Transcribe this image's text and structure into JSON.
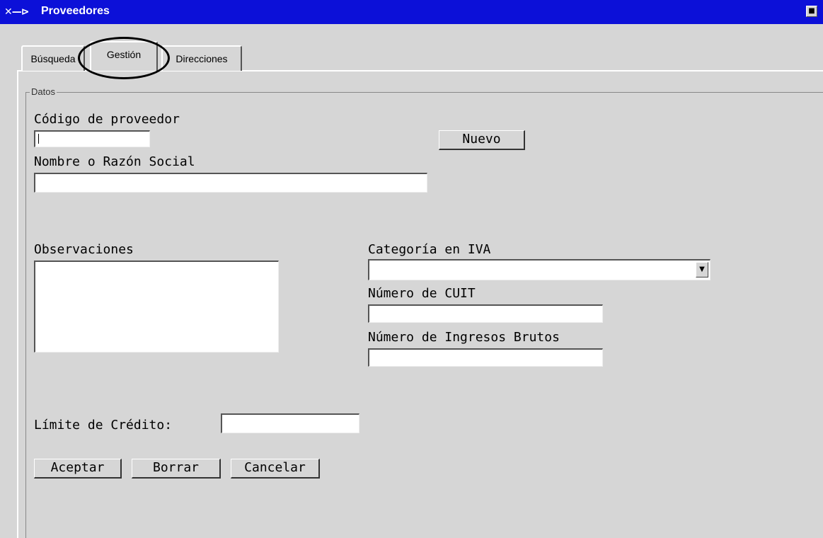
{
  "window": {
    "title": "Proveedores",
    "system_icon_text": "✕—⊳",
    "control_glyph": "■"
  },
  "tabs": [
    {
      "label": "Búsqueda",
      "active": false
    },
    {
      "label": "Gestión",
      "active": true
    },
    {
      "label": "Direcciones",
      "active": false
    }
  ],
  "group": {
    "legend": "Datos"
  },
  "form": {
    "codigo_label": "Código de proveedor",
    "codigo_value": "",
    "nuevo_button": "Nuevo",
    "nombre_label": "Nombre o Razón Social",
    "nombre_value": "",
    "observaciones_label": "Observaciones",
    "observaciones_value": "",
    "categoria_label": "Categoría en IVA",
    "categoria_value": "",
    "cuit_label": "Número de CUIT",
    "cuit_value": "",
    "ingresos_label": "Número de Ingresos Brutos",
    "ingresos_value": "",
    "limite_label": "Límite de Crédito:",
    "limite_value": ""
  },
  "actions": {
    "aceptar": "Aceptar",
    "borrar": "Borrar",
    "cancelar": "Cancelar"
  },
  "icons": {
    "dropdown": "chevron-down-icon",
    "window": "window-control-icon"
  },
  "colors": {
    "titlebar": "#0c10d8",
    "background": "#d6d6d6"
  }
}
